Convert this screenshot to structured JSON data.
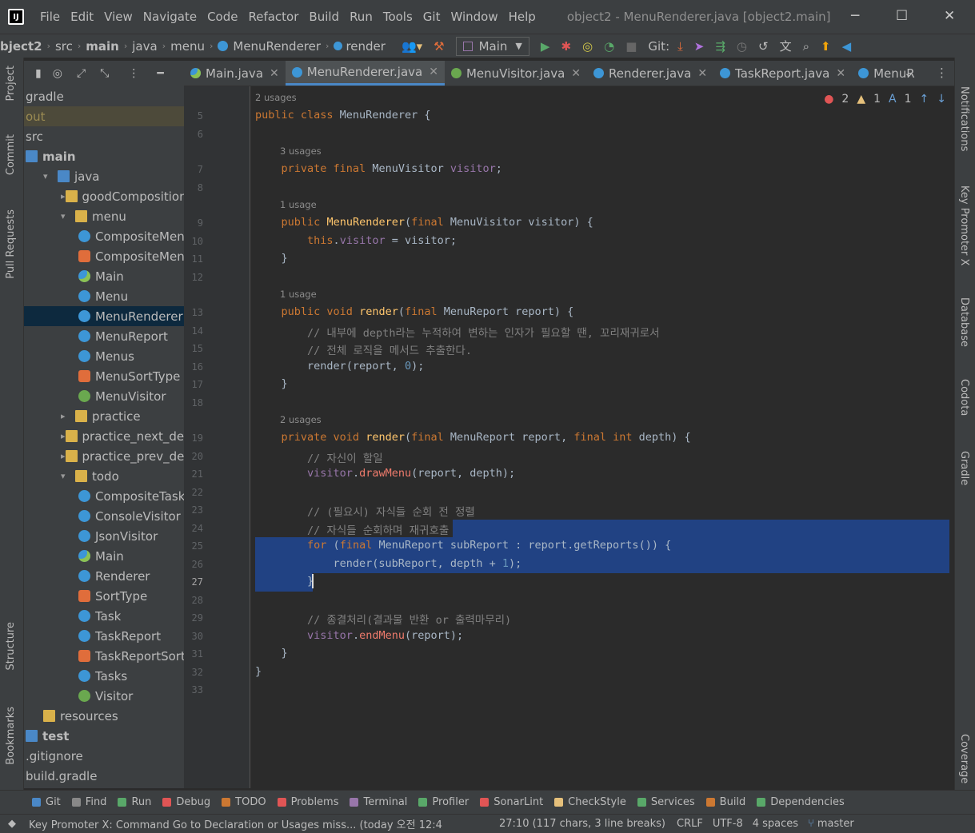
{
  "window": {
    "title": "object2 - MenuRenderer.java [object2.main]",
    "app_logo": "IJ",
    "menu": [
      "File",
      "Edit",
      "View",
      "Navigate",
      "Code",
      "Refactor",
      "Build",
      "Run",
      "Tools",
      "Git",
      "Window",
      "Help"
    ],
    "controls": {
      "minimize": "─",
      "maximize": "☐",
      "close": "✕"
    }
  },
  "breadcrumb": {
    "items": [
      "bject2",
      "src",
      "main",
      "java",
      "menu",
      "MenuRenderer",
      "render"
    ],
    "run_config": "Main",
    "git_label": "Git:"
  },
  "tabs": [
    {
      "label": "Main.java",
      "icon": "main-class-icon",
      "active": false
    },
    {
      "label": "MenuRenderer.java",
      "icon": "class-icon",
      "active": true
    },
    {
      "label": "MenuVisitor.java",
      "icon": "interface-icon",
      "active": false
    },
    {
      "label": "Renderer.java",
      "icon": "class-icon",
      "active": false
    },
    {
      "label": "TaskReport.java",
      "icon": "class-icon",
      "active": false
    },
    {
      "label": "MenuR",
      "icon": "class-icon",
      "active": false
    }
  ],
  "left_strip": [
    "Project",
    "Commit",
    "Pull Requests",
    "Structure",
    "Bookmarks"
  ],
  "right_strip": [
    "Notifications",
    "Key Promoter X",
    "Database",
    "Codota",
    "Gradle",
    "Coverage"
  ],
  "tree": [
    {
      "label": "gradle",
      "indent": 0,
      "arrow": "",
      "icon": "none"
    },
    {
      "label": "out",
      "indent": 0,
      "arrow": "",
      "icon": "none",
      "highlight": true
    },
    {
      "label": "src",
      "indent": 0,
      "arrow": "",
      "icon": "none"
    },
    {
      "label": "main",
      "indent": 0,
      "arrow": "",
      "icon": "srcfolder",
      "bold": true
    },
    {
      "label": "java",
      "indent": 1,
      "arrow": "▾",
      "icon": "srcfolder"
    },
    {
      "label": "goodComposition",
      "indent": 2,
      "arrow": "▸",
      "icon": "folder"
    },
    {
      "label": "menu",
      "indent": 2,
      "arrow": "▾",
      "icon": "folder"
    },
    {
      "label": "CompositeMenu",
      "indent": 3,
      "arrow": "",
      "icon": "class"
    },
    {
      "label": "CompositeMenu",
      "indent": 3,
      "arrow": "",
      "icon": "enum"
    },
    {
      "label": "Main",
      "indent": 3,
      "arrow": "",
      "icon": "main"
    },
    {
      "label": "Menu",
      "indent": 3,
      "arrow": "",
      "icon": "class"
    },
    {
      "label": "MenuRenderer",
      "indent": 3,
      "arrow": "",
      "icon": "class",
      "selected": true
    },
    {
      "label": "MenuReport",
      "indent": 3,
      "arrow": "",
      "icon": "class"
    },
    {
      "label": "Menus",
      "indent": 3,
      "arrow": "",
      "icon": "class"
    },
    {
      "label": "MenuSortType",
      "indent": 3,
      "arrow": "",
      "icon": "enum"
    },
    {
      "label": "MenuVisitor",
      "indent": 3,
      "arrow": "",
      "icon": "iface"
    },
    {
      "label": "practice",
      "indent": 2,
      "arrow": "▸",
      "icon": "folder"
    },
    {
      "label": "practice_next_deco_",
      "indent": 2,
      "arrow": "▸",
      "icon": "folder"
    },
    {
      "label": "practice_prev_deco_",
      "indent": 2,
      "arrow": "▸",
      "icon": "folder"
    },
    {
      "label": "todo",
      "indent": 2,
      "arrow": "▾",
      "icon": "folder"
    },
    {
      "label": "CompositeTask",
      "indent": 3,
      "arrow": "",
      "icon": "class"
    },
    {
      "label": "ConsoleVisitor",
      "indent": 3,
      "arrow": "",
      "icon": "class"
    },
    {
      "label": "JsonVisitor",
      "indent": 3,
      "arrow": "",
      "icon": "class"
    },
    {
      "label": "Main",
      "indent": 3,
      "arrow": "",
      "icon": "main"
    },
    {
      "label": "Renderer",
      "indent": 3,
      "arrow": "",
      "icon": "class"
    },
    {
      "label": "SortType",
      "indent": 3,
      "arrow": "",
      "icon": "enum"
    },
    {
      "label": "Task",
      "indent": 3,
      "arrow": "",
      "icon": "class"
    },
    {
      "label": "TaskReport",
      "indent": 3,
      "arrow": "",
      "icon": "class"
    },
    {
      "label": "TaskReportSortT",
      "indent": 3,
      "arrow": "",
      "icon": "enum"
    },
    {
      "label": "Tasks",
      "indent": 3,
      "arrow": "",
      "icon": "class"
    },
    {
      "label": "Visitor",
      "indent": 3,
      "arrow": "",
      "icon": "iface"
    },
    {
      "label": "resources",
      "indent": 1,
      "arrow": "",
      "icon": "folder"
    },
    {
      "label": "test",
      "indent": 0,
      "arrow": "",
      "icon": "srcfolder",
      "bold": true
    },
    {
      "label": ".gitignore",
      "indent": 0,
      "arrow": "",
      "icon": "none"
    },
    {
      "label": "build.gradle",
      "indent": 0,
      "arrow": "",
      "icon": "none"
    }
  ],
  "inspections": {
    "errors": "2",
    "warnings": "1",
    "typos": "1"
  },
  "code": [
    {
      "ln": "",
      "hint": "2 usages"
    },
    {
      "ln": "5",
      "html": "<span class='kw'>public class</span> MenuRenderer {"
    },
    {
      "ln": "6",
      "html": ""
    },
    {
      "ln": "",
      "hint": "3 usages"
    },
    {
      "ln": "7",
      "html": "    <span class='kw'>private final</span> MenuVisitor <span class='fld'>visitor</span>;"
    },
    {
      "ln": "8",
      "html": ""
    },
    {
      "ln": "",
      "hint": "1 usage"
    },
    {
      "ln": "9",
      "html": "    <span class='kw'>public</span> <span class='mth'>MenuRenderer</span>(<span class='kw'>final</span> MenuVisitor visitor) {"
    },
    {
      "ln": "10",
      "html": "        <span class='kw'>this</span>.<span class='fld'>visitor</span> = visitor;"
    },
    {
      "ln": "11",
      "html": "    }"
    },
    {
      "ln": "12",
      "html": ""
    },
    {
      "ln": "",
      "hint": "1 usage"
    },
    {
      "ln": "13",
      "html": "    <span class='kw'>public void</span> <span class='mth'>render</span>(<span class='kw'>final</span> MenuReport report) {"
    },
    {
      "ln": "14",
      "html": "        <span class='cmt'>// 내부에 depth라는 누적하여 변하는 인자가 필요할 땐, 꼬리재귀로서</span>"
    },
    {
      "ln": "15",
      "html": "        <span class='cmt'>// 전체 로직을 메서드 추출한다.</span>"
    },
    {
      "ln": "16",
      "html": "        render(report, <span class='num'>0</span>);"
    },
    {
      "ln": "17",
      "html": "    }"
    },
    {
      "ln": "18",
      "html": ""
    },
    {
      "ln": "",
      "hint": "2 usages"
    },
    {
      "ln": "19",
      "html": "    <span class='kw'>private void</span> <span class='mth'>render</span>(<span class='kw'>final</span> MenuReport report, <span class='kw'>final int</span> depth) {"
    },
    {
      "ln": "20",
      "html": "        <span class='cmt'>// 자신이 할일</span>"
    },
    {
      "ln": "21",
      "html": "        <span class='fld'>visitor</span>.<span class='call'>drawMenu</span>(report, depth);"
    },
    {
      "ln": "22",
      "html": ""
    },
    {
      "ln": "23",
      "html": "        <span class='cmt'>// (필요시) 자식들 순회 전 정렬</span>"
    },
    {
      "ln": "24",
      "html": "        <span class='cmt'>// 자식들 순회하며 재귀호출</span>"
    },
    {
      "ln": "25",
      "html": "        <span class='kw'>for</span> (<span class='kw'>final</span> MenuReport subReport : report.getReports()) {"
    },
    {
      "ln": "26",
      "html": "            render(subReport, depth + <span class='num'>1</span>);"
    },
    {
      "ln": "27",
      "html": "        }"
    },
    {
      "ln": "28",
      "html": ""
    },
    {
      "ln": "29",
      "html": "        <span class='cmt'>// 종결처리(결과물 반환 or 출력마무리)</span>"
    },
    {
      "ln": "30",
      "html": "        <span class='fld'>visitor</span>.<span class='call'>endMenu</span>(report);"
    },
    {
      "ln": "31",
      "html": "    }"
    },
    {
      "ln": "32",
      "html": "}"
    },
    {
      "ln": "33",
      "html": ""
    }
  ],
  "bottom_tools": [
    {
      "label": "Git",
      "color": "#4a88c7"
    },
    {
      "label": "Find",
      "color": "#888888"
    },
    {
      "label": "Run",
      "color": "#59a869"
    },
    {
      "label": "Debug",
      "color": "#e05555"
    },
    {
      "label": "TODO",
      "color": "#cc7832"
    },
    {
      "label": "Problems",
      "color": "#e05555"
    },
    {
      "label": "Terminal",
      "color": "#9876aa"
    },
    {
      "label": "Profiler",
      "color": "#59a869"
    },
    {
      "label": "SonarLint",
      "color": "#e05555"
    },
    {
      "label": "CheckStyle",
      "color": "#e5c07b"
    },
    {
      "label": "Services",
      "color": "#59a869"
    },
    {
      "label": "Build",
      "color": "#cc7832"
    },
    {
      "label": "Dependencies",
      "color": "#59a869"
    }
  ],
  "status": {
    "message": "Key Promoter X: Command Go to Declaration or Usages miss... (today 오전 12:4",
    "position": "27:10 (117 chars, 3 line breaks)",
    "line_sep": "CRLF",
    "encoding": "UTF-8",
    "indent": "4 spaces",
    "branch": "master"
  }
}
